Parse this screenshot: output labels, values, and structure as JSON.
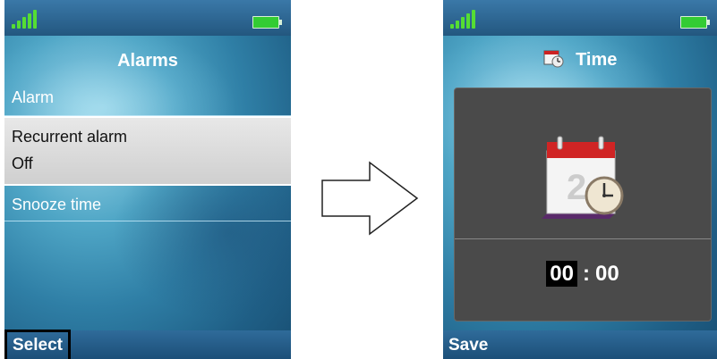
{
  "left_screen": {
    "title": "Alarms",
    "menu": [
      {
        "label": "Alarm"
      },
      {
        "label": "Recurrent alarm",
        "value": "Off",
        "selected": true
      },
      {
        "label": "Snooze time"
      }
    ],
    "softkey": "Select"
  },
  "right_screen": {
    "title": "Time",
    "title_icon": "calendar-clock-icon",
    "large_icon": "calendar-clock-icon",
    "calendar_day": "2",
    "time": {
      "hours": "00",
      "separator": ":",
      "minutes": "00"
    },
    "softkey": "Save"
  },
  "icons": {
    "signal": "signal-strength-icon",
    "battery": "battery-icon",
    "transition": "arrow-right-icon"
  },
  "colors": {
    "status_bar": "#23577f",
    "highlight": "#d8d8d8",
    "panel": "#4a4a4a",
    "signal": "#55dd33",
    "battery": "#33cc33"
  }
}
